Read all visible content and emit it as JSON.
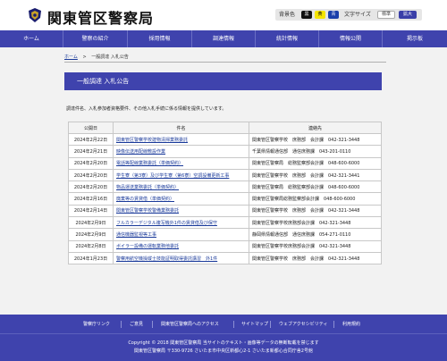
{
  "header": {
    "site_title": "関東管区警察局",
    "bg_label": "背景色",
    "bg_black": "黒",
    "bg_yellow": "黄",
    "bg_blue": "青",
    "font_label": "文字サイズ",
    "font_standard": "標準",
    "font_large": "拡大",
    "colors": {
      "black": "#111111",
      "yellow": "#f5e400",
      "blue": "#1a3faa"
    }
  },
  "nav": {
    "items": [
      "ホーム",
      "警察の紹介",
      "採用情報",
      "調達情報",
      "統計情報",
      "情報公開",
      "掲示板"
    ]
  },
  "breadcrumb": {
    "home": "ホーム",
    "separator": ">",
    "current": "一般調達 入札公告"
  },
  "page": {
    "heading": "一般調達 入札公告",
    "intro": "調達件名、入札参加者資格要件、その他入札手続に係る情報を提供しています。"
  },
  "table": {
    "headers": [
      "公開日",
      "件名",
      "連絡先"
    ],
    "rows": [
      {
        "date": "2024年2月22日",
        "name": "関東管区警察学校建物清掃業務委託",
        "contact": "関東管区警察学校　庶務部　会計課　042-321-3448"
      },
      {
        "date": "2024年2月21日",
        "name": "映像伝送用配線敷設作業",
        "contact": "千葉県情報通信部　通信庶務課　043-201-0110"
      },
      {
        "date": "2024年2月20日",
        "name": "電話等配線業務委託（単価契約）",
        "contact": "関東管区警察局　総務監察部会計課　048-600-6000"
      },
      {
        "date": "2024年2月20日",
        "name": "学生寮（第3寮）及び学生寮（第6寮）空調設備更新工事",
        "contact": "関東管区警察学校　庶務部　会計課　042-321-3441"
      },
      {
        "date": "2024年2月20日",
        "name": "物品運送業務委託（単価契約）",
        "contact": "関東管区警察局　総務監察部会計課　048-600-6000"
      },
      {
        "date": "2024年2月16日",
        "name": "廃棄等の賃貸借（単価契約）",
        "contact": "関東管区警察局総務監察部会計課　048-600-6000"
      },
      {
        "date": "2024年2月14日",
        "name": "関東管区警察学校警備業務委託",
        "contact": "関東管区警察学校　庶務部　会計課　042-321-3448"
      },
      {
        "date": "2024年2月9日",
        "name": "フルカラーデジタル複写機外1件の賃貸借及び保守",
        "contact": "関東管区警察学校庶務部会計課　042-321-3448"
      },
      {
        "date": "2024年2月9日",
        "name": "通信機器監視等工事",
        "contact": "静岡県情報通信部　通信庶務課　054-271-0110"
      },
      {
        "date": "2024年2月8日",
        "name": "ボイラー設備の運転業務他委託",
        "contact": "関東管区警察学校庶務部会計課　042-321-3448"
      },
      {
        "date": "2024年1月23日",
        "name": "警察用航空機操縦士技能証明取得委託講習　外1件",
        "contact": "関東管区警察学校　庶務部　会計課　042-321-3448"
      }
    ]
  },
  "footer": {
    "links": [
      "警察庁リンク",
      "ご意見",
      "関東管区警察局へのアクセス",
      "サイトマップ",
      "ウェブアクセシビリティ",
      "利用規約"
    ],
    "copyright": "Copyright © 2018 関東管区警察局 当サイトのテキスト・画像等データの無断転載を禁じます",
    "address": "関東管区警察局 〒330-9726 さいたま市中央区新都心2-1 さいたま新都心合同庁舎2号館"
  }
}
